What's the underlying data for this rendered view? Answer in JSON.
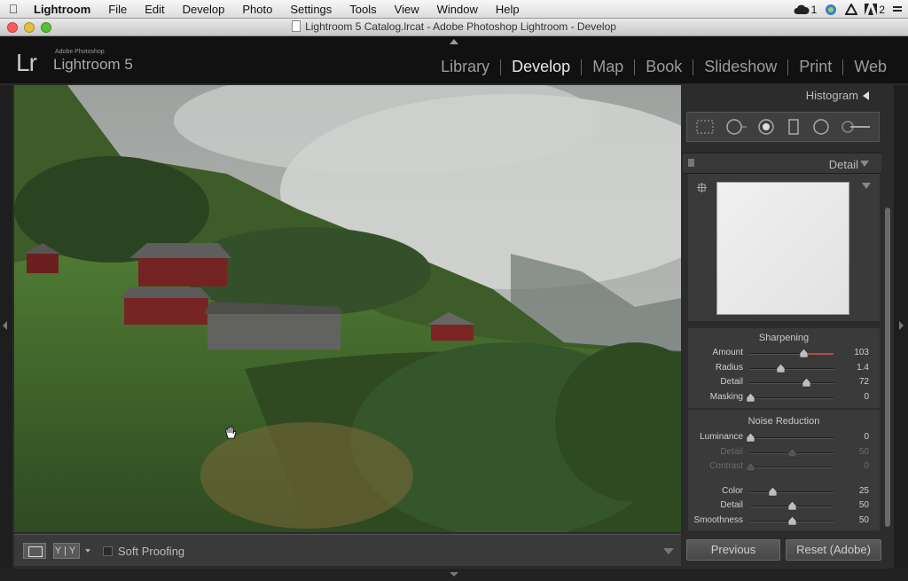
{
  "menubar": {
    "app": "Lightroom",
    "items": [
      "File",
      "Edit",
      "Develop",
      "Photo",
      "Settings",
      "Tools",
      "View",
      "Window",
      "Help"
    ],
    "status_count_1": "1",
    "status_count_2": "2"
  },
  "window": {
    "title": "Lightroom 5 Catalog.lrcat - Adobe Photoshop Lightroom - Develop"
  },
  "header": {
    "logo": "Lr",
    "brand_small": "Adobe Photoshop",
    "brand": "Lightroom 5",
    "modules": [
      "Library",
      "Develop",
      "Map",
      "Book",
      "Slideshow",
      "Print",
      "Web"
    ],
    "active_module": "Develop"
  },
  "toolbar": {
    "yy_label": "Y|Y",
    "soft_proofing": "Soft Proofing"
  },
  "panel": {
    "histogram_label": "Histogram",
    "detail_label": "Detail",
    "sharpening": {
      "title": "Sharpening",
      "rows": [
        {
          "label": "Amount",
          "value": "103",
          "pos": 0.64
        },
        {
          "label": "Radius",
          "value": "1.4",
          "pos": 0.36
        },
        {
          "label": "Detail",
          "value": "72",
          "pos": 0.67
        },
        {
          "label": "Masking",
          "value": "0",
          "pos": 0.0
        }
      ]
    },
    "noise": {
      "title": "Noise Reduction",
      "rows": [
        {
          "label": "Luminance",
          "value": "0",
          "pos": 0.0,
          "dim": false
        },
        {
          "label": "Detail",
          "value": "50",
          "pos": 0.5,
          "dim": true
        },
        {
          "label": "Contrast",
          "value": "0",
          "pos": 0.0,
          "dim": true
        },
        {
          "label": "Color",
          "value": "25",
          "pos": 0.27,
          "dim": false
        },
        {
          "label": "Detail",
          "value": "50",
          "pos": 0.5,
          "dim": false
        },
        {
          "label": "Smoothness",
          "value": "50",
          "pos": 0.5,
          "dim": false
        }
      ]
    },
    "previous_button": "Previous",
    "reset_button": "Reset (Adobe)"
  },
  "colors": {
    "accent_red": "#b84a4a",
    "panel_bg": "#2c2c2c"
  }
}
